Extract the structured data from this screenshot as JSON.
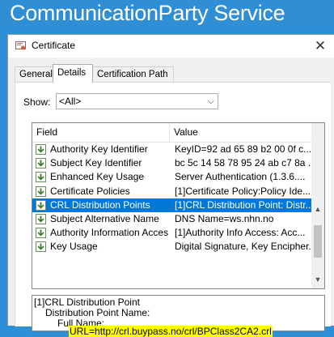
{
  "banner": {
    "title": "CommunicationParty Service"
  },
  "dialog": {
    "title": "Certificate",
    "close_glyph": "✕"
  },
  "tabs": [
    {
      "label": "General"
    },
    {
      "label": "Details"
    },
    {
      "label": "Certification Path"
    }
  ],
  "show": {
    "label": "Show:",
    "selected": "<All>"
  },
  "columns": {
    "field": "Field",
    "value": "Value"
  },
  "rows": [
    {
      "field": "Authority Key Identifier",
      "value": "KeyID=92 ad 65 89 b2 00 0f c..."
    },
    {
      "field": "Subject Key Identifier",
      "value": "bc 5c 14 58 78 95 24 ab c7 8a ..."
    },
    {
      "field": "Enhanced Key Usage",
      "value": "Server Authentication (1.3.6...."
    },
    {
      "field": "Certificate Policies",
      "value": "[1]Certificate Policy:Policy Ide..."
    },
    {
      "field": "CRL Distribution Points",
      "value": "[1]CRL Distribution Point: Distr..."
    },
    {
      "field": "Subject Alternative Name",
      "value": "DNS Name=ws.nhn.no"
    },
    {
      "field": "Authority Information Access",
      "value": "[1]Authority Info Access: Acc..."
    },
    {
      "field": "Key Usage",
      "value": "Digital Signature, Key Encipher..."
    }
  ],
  "selected_row": "CRL Distribution Points",
  "detail": {
    "line1": "[1]CRL Distribution Point",
    "line2": "Distribution Point Name:",
    "line3": "Full Name:",
    "line4": "URL=http://crl.buypass.no/crl/BPClass2CA2.crl"
  },
  "colors": {
    "banner": "#2f8ed4",
    "selection": "#0078d7",
    "highlight": "#ffff00"
  }
}
